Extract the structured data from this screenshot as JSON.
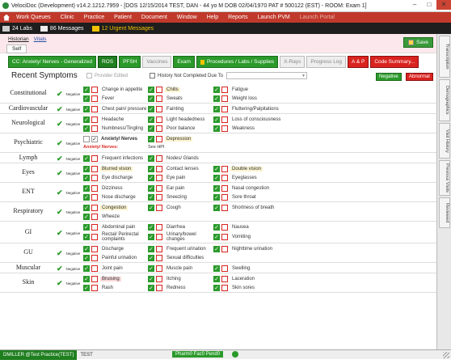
{
  "titlebar": {
    "title": "VelociDoc (Development) v14.2.1212.7959 - [DOS 12/15/2014 TEST, DAN - 44 yo M DOB 02/04/1970 PAT # 500122 (EST) - ROOM: Exam 1]"
  },
  "menu": [
    "Work Queues",
    "Clinic",
    "Practice",
    "Patient",
    "Document",
    "Window",
    "Help",
    "Reports",
    "Launch PVM"
  ],
  "menu_disabled": "Launch Portal",
  "status": {
    "labs": "24 Labs",
    "messages": "86 Messages",
    "urgent": "12 Urgent Messages"
  },
  "rail": [
    "Transcription",
    "Demographics",
    "Visit History",
    "Previous Visits",
    "Reviewed"
  ],
  "hdr": {
    "historian": "Historian",
    "vitals": "Vitals",
    "self": "Self",
    "save": "Save"
  },
  "tabs": [
    {
      "label": "CC: Anxiety/ Nerves - Generalized",
      "style": "g"
    },
    {
      "label": "ROS",
      "style": "ga"
    },
    {
      "label": "PFSH",
      "style": "g"
    },
    {
      "label": "Vaccines",
      "style": "gr"
    },
    {
      "label": "Exam",
      "style": "g"
    },
    {
      "label": "Procedures / Labs / Supplies",
      "style": "g",
      "lock": true
    },
    {
      "label": "X-Rays",
      "style": "gr"
    },
    {
      "label": "Progress Log",
      "style": "gr"
    },
    {
      "label": "A & P",
      "style": "r"
    },
    {
      "label": "Code Summary...",
      "style": "r"
    }
  ],
  "recent": {
    "title": "Recent Symptoms",
    "provider_edited": "Provider Edited",
    "history_not": "History Not Completed Due To",
    "negative": "Negative",
    "abnormal": "Abnormal"
  },
  "neg_label": "Negative",
  "systems": [
    {
      "name": "Constitutional",
      "items": [
        [
          "Change in appetite",
          "Chills",
          "Fatigue"
        ],
        [
          "Fever",
          "Sweats",
          "Weight loss"
        ]
      ]
    },
    {
      "name": "Cardiovascular",
      "items": [
        [
          "Chest pain/ pressure",
          "Fainting",
          "Fluttering/Palpitations"
        ]
      ]
    },
    {
      "name": "Neurological",
      "items": [
        [
          "Headache",
          "Light headedness",
          "Loss of consciousness"
        ],
        [
          "Numbness/Tingling",
          "Poor balance",
          "Weakness"
        ]
      ]
    },
    {
      "name": "Psychiatric",
      "items": [
        [
          "Anxiety/ Nerves",
          "Depression",
          ""
        ]
      ],
      "sub1": "Anxiety/ Nerves:",
      "sub2": "See HPI"
    },
    {
      "name": "Lymph",
      "items": [
        [
          "Frequent infections",
          "Nodes/ Glands",
          ""
        ]
      ]
    },
    {
      "name": "Eyes",
      "items": [
        [
          "Blurred vision",
          "Contact lenses",
          "Double vision"
        ],
        [
          "Eye discharge",
          "Eye pain",
          "Eyeglasses"
        ]
      ]
    },
    {
      "name": "ENT",
      "items": [
        [
          "Dizziness",
          "Ear pain",
          "Nasal congestion"
        ],
        [
          "Nose discharge",
          "Sneezing",
          "Sore throat"
        ]
      ]
    },
    {
      "name": "Respiratory",
      "items": [
        [
          "Congestion",
          "Cough",
          "Shortness of breath"
        ],
        [
          "Wheeze",
          "",
          ""
        ]
      ]
    },
    {
      "name": "GI",
      "items": [
        [
          "Abdominal pain",
          "Diarrhea",
          "Nausea"
        ],
        [
          "Rectal/ Perirectal complaints",
          "Urinary/bowel changes",
          "Vomiting"
        ]
      ]
    },
    {
      "name": "GU",
      "items": [
        [
          "Discharge",
          "Frequent urination",
          "Nighttime urination"
        ],
        [
          "Painful urination",
          "Sexual difficulties",
          ""
        ]
      ]
    },
    {
      "name": "Muscular",
      "items": [
        [
          "Joint pain",
          "Muscle pain",
          "Swelling"
        ]
      ]
    },
    {
      "name": "Skin",
      "items": [
        [
          "Bruising",
          "Itching",
          "Laceration"
        ],
        [
          "Rash",
          "Redness",
          "Skin sores"
        ]
      ]
    }
  ],
  "bottom": {
    "user": "DMILLER @Test Practice(TEST)",
    "test": "TEST",
    "pharm": "Pharm0 Fac0 Pend0"
  }
}
